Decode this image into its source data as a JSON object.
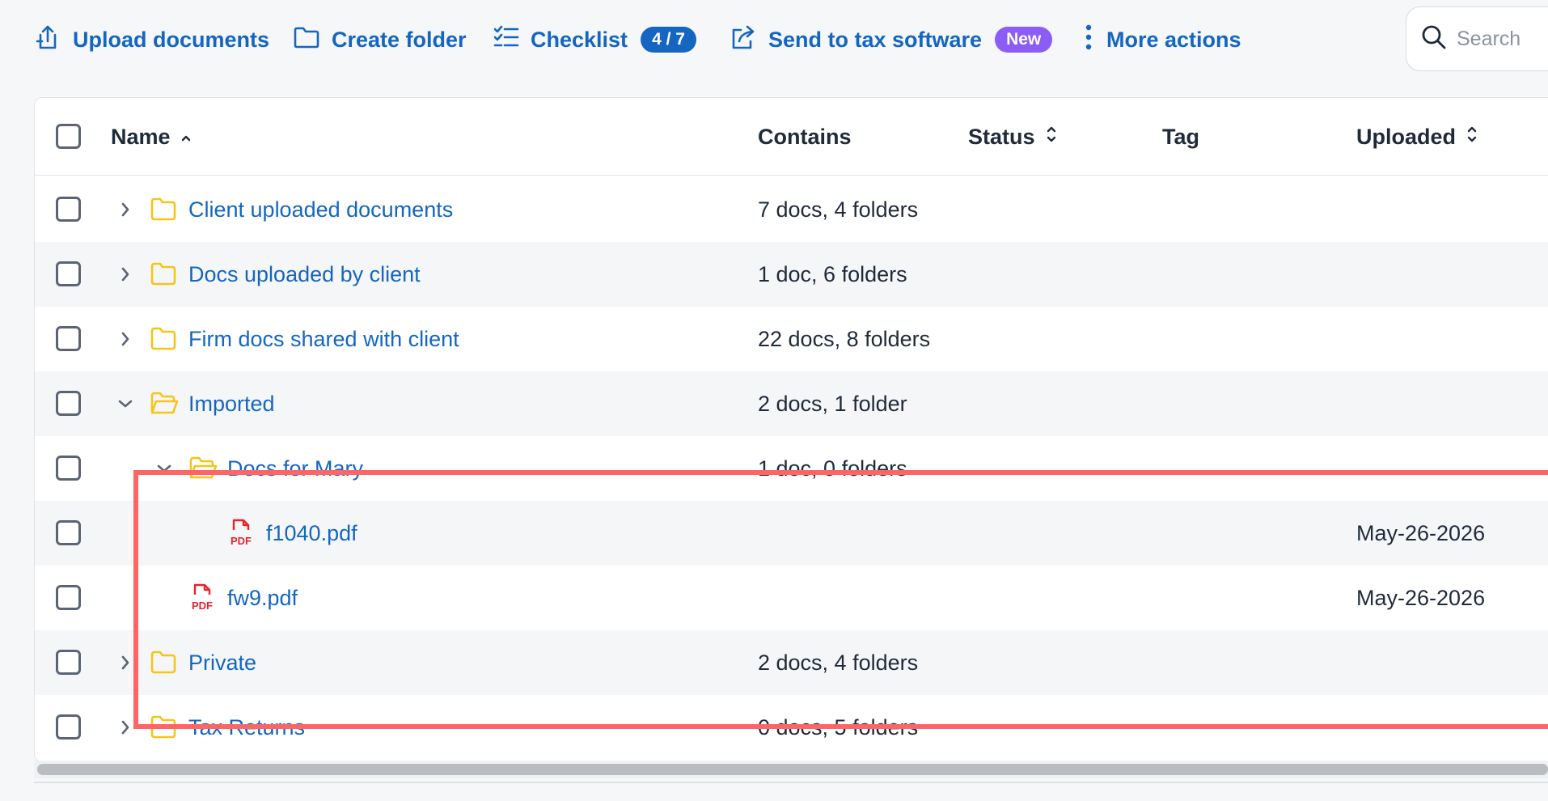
{
  "toolbar": {
    "upload_label": "Upload documents",
    "create_folder_label": "Create folder",
    "checklist_label": "Checklist",
    "checklist_badge": "4 / 7",
    "send_label": "Send to tax software",
    "send_badge": "New",
    "more_label": "More actions",
    "search_placeholder": "Search"
  },
  "table": {
    "headers": {
      "name": "Name",
      "contains": "Contains",
      "status": "Status",
      "tag": "Tag",
      "uploaded": "Uploaded"
    },
    "rows": [
      {
        "name": "Client uploaded documents",
        "contains": "7 docs, 4 folders",
        "uploaded": "",
        "type": "folder",
        "expanded": false,
        "level": 0
      },
      {
        "name": "Docs uploaded by client",
        "contains": "1 doc, 6 folders",
        "uploaded": "",
        "type": "folder",
        "expanded": false,
        "level": 0
      },
      {
        "name": "Firm docs shared with client",
        "contains": "22 docs, 8 folders",
        "uploaded": "",
        "type": "folder",
        "expanded": false,
        "level": 0
      },
      {
        "name": "Imported",
        "contains": "2 docs, 1 folder",
        "uploaded": "",
        "type": "folder",
        "expanded": true,
        "level": 0
      },
      {
        "name": "Docs for Mary",
        "contains": "1 doc, 0 folders",
        "uploaded": "",
        "type": "folder",
        "expanded": true,
        "level": 1
      },
      {
        "name": "f1040.pdf",
        "contains": "",
        "uploaded": "May-26-2026",
        "type": "pdf",
        "level": 2
      },
      {
        "name": "fw9.pdf",
        "contains": "",
        "uploaded": "May-26-2026",
        "type": "pdf",
        "level": 1
      },
      {
        "name": "Private",
        "contains": "2 docs, 4 folders",
        "uploaded": "",
        "type": "folder",
        "expanded": false,
        "level": 0
      },
      {
        "name": "Tax Returns",
        "contains": "0 docs, 5 folders",
        "uploaded": "",
        "type": "folder",
        "expanded": false,
        "level": 0
      }
    ]
  },
  "icons": {
    "upload": "upload-icon",
    "folder": "folder-icon",
    "checklist": "checklist-icon",
    "send": "share-icon",
    "more": "kebab-icon",
    "search": "search-icon",
    "pdf": "pdf-file-icon"
  },
  "colors": {
    "link": "#1466c1",
    "folder": "#f5c518",
    "pdf": "#e5252a",
    "badge_blue": "#1466c1",
    "badge_purple": "#8b5cf6",
    "highlight": "#ff6565"
  }
}
